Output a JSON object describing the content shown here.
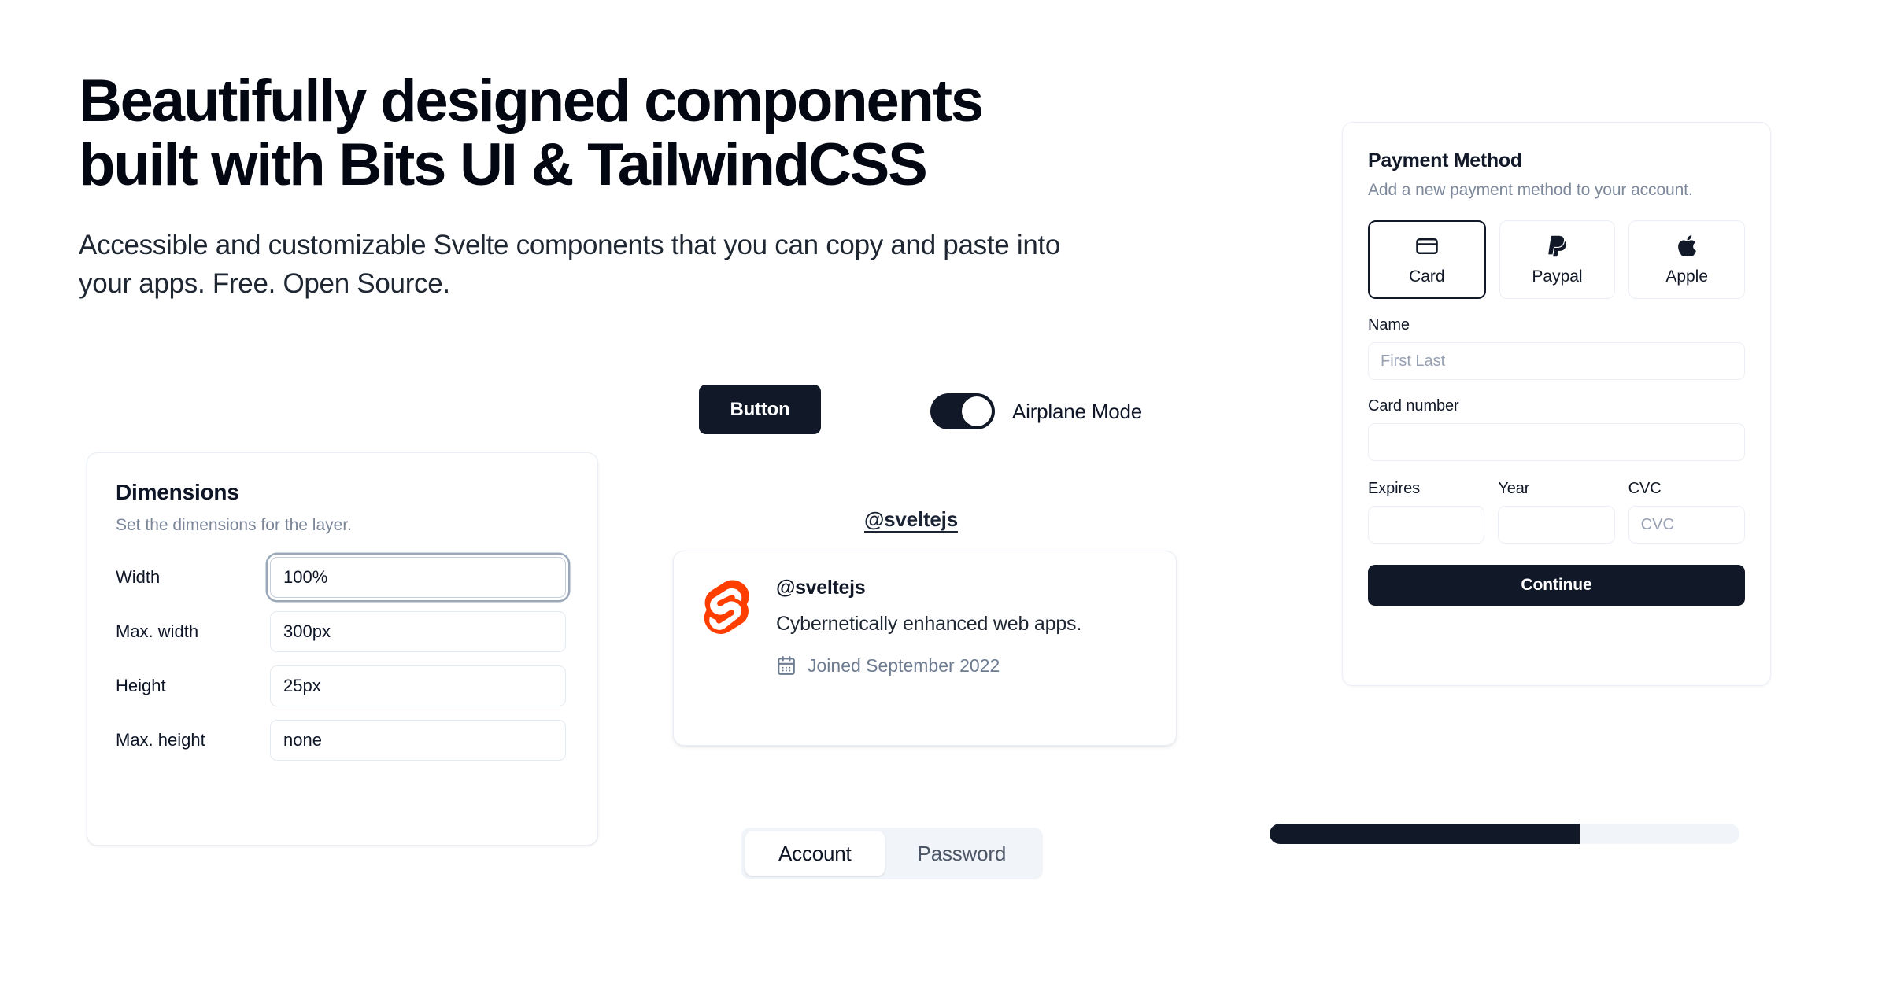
{
  "hero": {
    "heading_line1": "Beautifully designed components",
    "heading_line2": "built with Bits UI & TailwindCSS",
    "subheading": "Accessible and customizable Svelte components that you can copy and paste into your apps. Free. Open Source."
  },
  "dimensions_card": {
    "title": "Dimensions",
    "description": "Set the dimensions for the layer.",
    "fields": [
      {
        "label": "Width",
        "value": "100%",
        "focused": true
      },
      {
        "label": "Max. width",
        "value": "300px",
        "focused": false
      },
      {
        "label": "Height",
        "value": "25px",
        "focused": false
      },
      {
        "label": "Max. height",
        "value": "none",
        "focused": false
      }
    ]
  },
  "demo": {
    "button_label": "Button",
    "switch_label": "Airplane Mode",
    "switch_state": "on"
  },
  "hover_card": {
    "trigger_label": "@sveltejs",
    "name": "@sveltejs",
    "description": "Cybernetically enhanced web apps.",
    "joined": "Joined September 2022",
    "avatar_icon": "svelte-logo-icon",
    "calendar_icon": "calendar-icon",
    "brand_color": "#FF3E00"
  },
  "tabs": {
    "items": [
      {
        "label": "Account",
        "active": true
      },
      {
        "label": "Password",
        "active": false
      }
    ]
  },
  "payment_card": {
    "title": "Payment Method",
    "description": "Add a new payment method to your account.",
    "methods": [
      {
        "label": "Card",
        "icon": "credit-card-icon",
        "selected": true
      },
      {
        "label": "Paypal",
        "icon": "paypal-icon",
        "selected": false
      },
      {
        "label": "Apple",
        "icon": "apple-icon",
        "selected": false
      }
    ],
    "name_label": "Name",
    "name_placeholder": "First Last",
    "name_value": "",
    "card_number_label": "Card number",
    "card_number_placeholder": "",
    "card_number_value": "",
    "expires_label": "Expires",
    "expires_placeholder": "",
    "expires_value": "",
    "year_label": "Year",
    "year_placeholder": "",
    "year_value": "",
    "cvc_label": "CVC",
    "cvc_placeholder": "CVC",
    "cvc_value": "",
    "continue_label": "Continue",
    "accent_color": "#111827"
  },
  "progress": {
    "percent": 66,
    "fill_color": "#111827",
    "track_color": "#f1f5f9"
  }
}
